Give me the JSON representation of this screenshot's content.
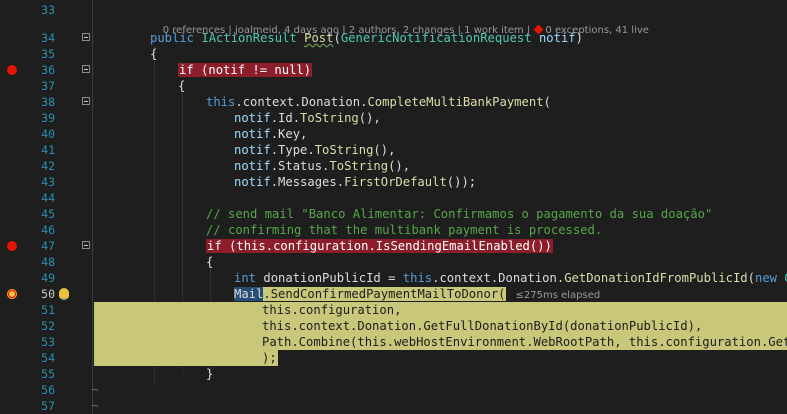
{
  "codelens": {
    "references": "0 references",
    "author": "joalmeid, 4 days ago",
    "authors": "2 authors, 2 changes",
    "work_item": "1 work item",
    "exceptions": "0 exceptions, 41 live"
  },
  "lines": {
    "l33": "33",
    "l34": "34",
    "l35": "35",
    "l36": "36",
    "l37": "37",
    "l38": "38",
    "l39": "39",
    "l40": "40",
    "l41": "41",
    "l42": "42",
    "l43": "43",
    "l44": "44",
    "l45": "45",
    "l46": "46",
    "l47": "47",
    "l48": "48",
    "l49": "49",
    "l50": "50",
    "l51": "51",
    "l52": "52",
    "l53": "53",
    "l54": "54",
    "l55": "55",
    "l56": "56",
    "l57": "57"
  },
  "code": {
    "l34_public": "public",
    "l34_type": "IActionResult",
    "l34_name": "Post",
    "l34_paramtype": "GenericNotificationRequest",
    "l34_param": "notif",
    "l35": "{",
    "l36_if": "if",
    "l36_cond": "(notif != null)",
    "l37": "{",
    "l38_this": "this",
    "l38_rest": ".context.Donation.",
    "l38_fn": "CompleteMultiBankPayment",
    "l38_end": "(",
    "l39_notif": "notif",
    "l39_prop": ".Id.",
    "l39_fn": "ToString",
    "l39_end": "(),",
    "l40_notif": "notif",
    "l40_rest": ".Key,",
    "l41_notif": "notif",
    "l41_prop": ".Type.",
    "l41_fn": "ToString",
    "l41_end": "(),",
    "l42_notif": "notif",
    "l42_prop": ".Status.",
    "l42_fn": "ToString",
    "l42_end": "(),",
    "l43_notif": "notif",
    "l43_prop": ".Messages.",
    "l43_fn": "FirstOrDefault",
    "l43_end": "());",
    "l45": "// send mail \"Banco Alimentar: Confirmamos o pagamento da sua doação\"",
    "l46": "// confirming that the multibank payment is processed.",
    "l47_if": "if",
    "l47_open": " (",
    "l47_this": "this",
    "l47_rest": ".configuration.IsSendingEmailEnabled())",
    "l48": "{",
    "l49_int": "int",
    "l49_var": " donationPublicId = ",
    "l49_this": "this",
    "l49_rest": ".context.Donation.",
    "l49_fn": "GetDonationIdFromPublicId",
    "l49_end": "(",
    "l49_new": "new",
    "l49_tail": " Guid",
    "l50_mail": "Mail",
    "l50_rest": ".SendConfirmedPaymentMailToDonor(",
    "l50_elapsed": "≤275ms elapsed",
    "l51": "this.configuration,",
    "l52": "this.context.Donation.GetFullDonationById(donationPublicId),",
    "l53": "Path.Combine(this.webHostEnvironment.WebRootPath, this.configuration.GetFil",
    "l54": ");",
    "l55": "}"
  },
  "colors": {
    "background": "#1e1e1e",
    "breakpoint": "#e51400",
    "breakpoint_line": "#8b1e2a",
    "current_statement": "#c8c77a"
  }
}
